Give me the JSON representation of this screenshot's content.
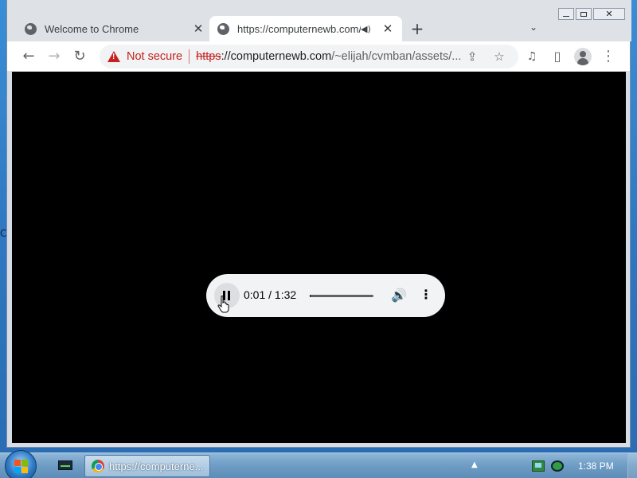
{
  "desktop": {
    "edge_text": "C"
  },
  "window_controls": {
    "minimize": "",
    "maximize": "",
    "close": "✕"
  },
  "tabs": [
    {
      "title": "Welcome to Chrome",
      "close": "✕"
    },
    {
      "title": "https://computernewb.com/",
      "close": "✕",
      "audio": "◀)"
    }
  ],
  "tabstrip": {
    "new_tab": "+",
    "tab_search": "⌄"
  },
  "toolbar": {
    "back": "←",
    "forward": "→",
    "reload": "↻",
    "security_label": "Not secure",
    "url_scheme": "https",
    "url_host": "://computernewb.com",
    "url_path": "/~elijah/cvmban/assets/...",
    "share": "⇪",
    "bookmark": "☆",
    "media": "♫",
    "sidepanel": "▯",
    "menu": "⋮"
  },
  "player": {
    "current_time": "0:01",
    "duration": "1:32",
    "time_display": "0:01 / 1:32",
    "progress": 0.01,
    "volume_icon": "🔊",
    "more_icon": "⋮"
  },
  "taskbar": {
    "app_title": "https://computerne...",
    "tray_expand": "▲",
    "clock": "1:38 PM"
  },
  "colors": {
    "accent_red": "#c5221f",
    "taskbar": "#6e9cc4",
    "content_bg": "#000000"
  }
}
